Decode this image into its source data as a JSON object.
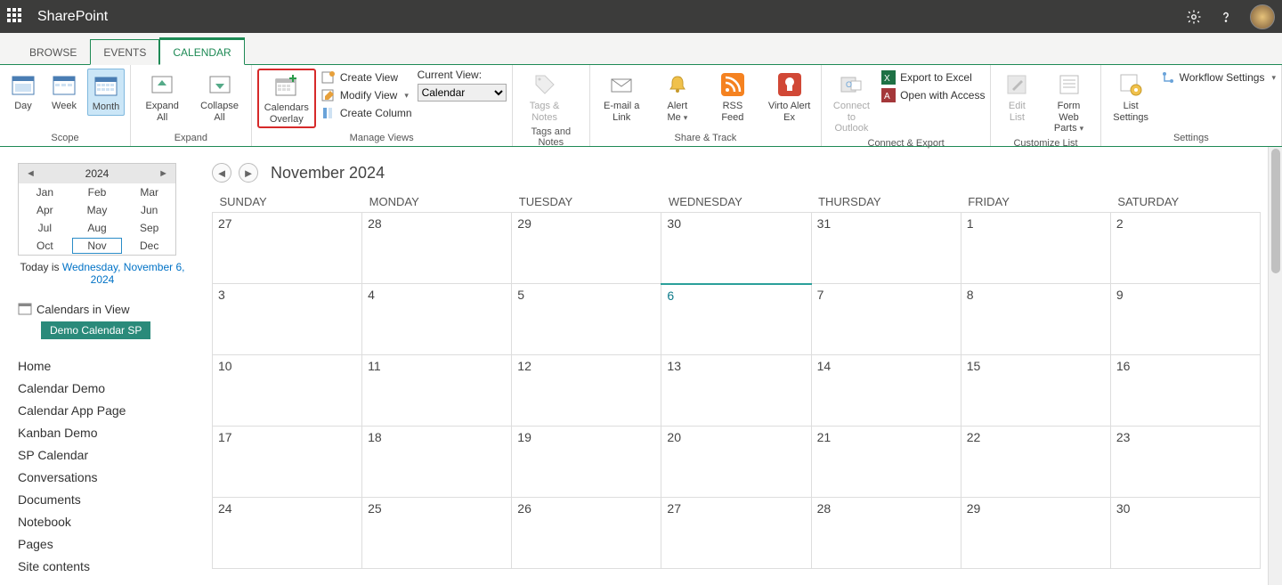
{
  "topbar": {
    "brand": "SharePoint"
  },
  "tabs": {
    "browse": "BROWSE",
    "events": "EVENTS",
    "calendar": "CALENDAR"
  },
  "ribbon": {
    "scope": {
      "label": "Scope",
      "day": "Day",
      "week": "Week",
      "month": "Month"
    },
    "expand": {
      "label": "Expand",
      "expand_all": "Expand All",
      "collapse_all": "Collapse All"
    },
    "overlay": {
      "btn": "Calendars Overlay"
    },
    "manage": {
      "label": "Manage Views",
      "create_view": "Create View",
      "modify_view": "Modify View",
      "create_column": "Create Column",
      "current_view_label": "Current View:",
      "current_view_value": "Calendar"
    },
    "tags": {
      "label": "Tags and Notes",
      "btn": "Tags & Notes"
    },
    "share": {
      "label": "Share & Track",
      "email": "E-mail a Link",
      "alert": "Alert Me",
      "rss": "RSS Feed",
      "virto": "Virto Alert Ex"
    },
    "connect": {
      "label": "Connect & Export",
      "outlook": "Connect to Outlook",
      "excel": "Export to Excel",
      "access": "Open with Access"
    },
    "customize": {
      "label": "Customize List",
      "edit_list": "Edit List",
      "form_web": "Form Web Parts"
    },
    "settings": {
      "label": "Settings",
      "list_settings": "List Settings",
      "workflow": "Workflow Settings"
    }
  },
  "mini": {
    "year": "2024",
    "months": [
      "Jan",
      "Feb",
      "Mar",
      "Apr",
      "May",
      "Jun",
      "Jul",
      "Aug",
      "Sep",
      "Oct",
      "Nov",
      "Dec"
    ],
    "current": "Nov",
    "today_prefix": "Today is ",
    "today_link": "Wednesday, November 6, 2024"
  },
  "calinview": {
    "title": "Calendars in View",
    "badge": "Demo Calendar SP"
  },
  "nav": [
    "Home",
    "Calendar Demo",
    "Calendar App Page",
    "Kanban Demo",
    "SP Calendar",
    "Conversations",
    "Documents",
    "Notebook",
    "Pages",
    "Site contents"
  ],
  "calendar": {
    "title": "November 2024",
    "dow": [
      "SUNDAY",
      "MONDAY",
      "TUESDAY",
      "WEDNESDAY",
      "THURSDAY",
      "FRIDAY",
      "SATURDAY"
    ],
    "weeks": [
      [
        "27",
        "28",
        "29",
        "30",
        "31",
        "1",
        "2"
      ],
      [
        "3",
        "4",
        "5",
        "6",
        "7",
        "8",
        "9"
      ],
      [
        "10",
        "11",
        "12",
        "13",
        "14",
        "15",
        "16"
      ],
      [
        "17",
        "18",
        "19",
        "20",
        "21",
        "22",
        "23"
      ],
      [
        "24",
        "25",
        "26",
        "27",
        "28",
        "29",
        "30"
      ]
    ],
    "today": "6"
  }
}
